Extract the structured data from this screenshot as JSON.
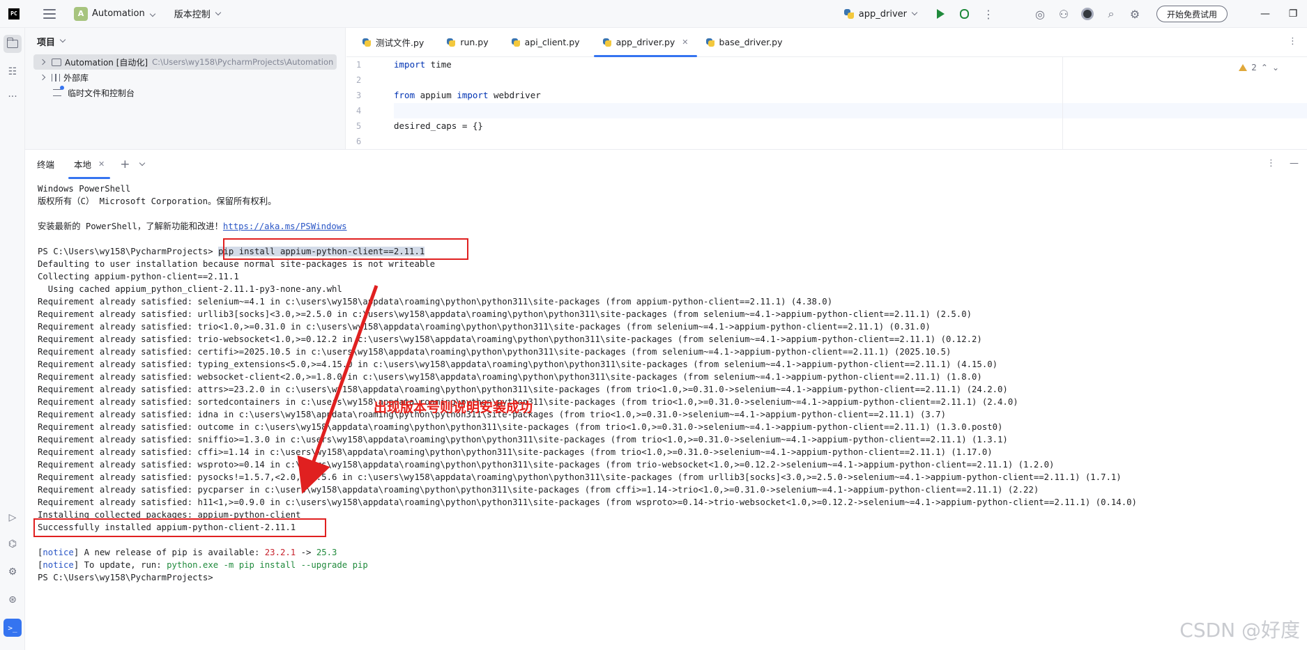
{
  "titlebar": {
    "logo": "PC",
    "project_badge": "A",
    "project_name": "Automation",
    "vcs_label": "版本控制",
    "run_config": "app_driver",
    "upgrade_button": "开始免费试用"
  },
  "left_strip": {
    "icons": [
      "folder-icon",
      "structure-icon",
      "more-icon",
      "run-icon",
      "python-console-icon",
      "services-icon",
      "debug-icon",
      "terminal-icon"
    ]
  },
  "project_panel": {
    "title": "项目",
    "tree": [
      {
        "label": "Automation [自动化]",
        "path": "C:\\Users\\wy158\\PycharmProjects\\Automation"
      },
      {
        "label": "外部库",
        "path": ""
      },
      {
        "label": "临时文件和控制台",
        "path": ""
      }
    ]
  },
  "editor": {
    "tabs": [
      {
        "label": "测试文件.py",
        "active": false
      },
      {
        "label": "run.py",
        "active": false
      },
      {
        "label": "api_client.py",
        "active": false
      },
      {
        "label": "app_driver.py",
        "active": true
      },
      {
        "label": "base_driver.py",
        "active": false
      }
    ],
    "warnings": "2",
    "line_numbers": [
      "1",
      "2",
      "3",
      "4",
      "5",
      "6"
    ],
    "code": {
      "l1_kw": "import",
      "l1_rest": " time",
      "l3_kw1": "from",
      "l3_mid": " appium ",
      "l3_kw2": "import",
      "l3_rest": " webdriver",
      "l5": "desired_caps = {}"
    }
  },
  "terminal_panel": {
    "title": "终端",
    "tab_label": "本地",
    "lines": {
      "l1": "Windows PowerShell",
      "l2": "版权所有（C） Microsoft Corporation。保留所有权利。",
      "l4_text": "安装最新的 PowerShell，了解新功能和改进！",
      "l4_link": "https://aka.ms/PSWindows",
      "l6_prompt": "PS C:\\Users\\wy158\\PycharmProjects> ",
      "l6_cmd": "pip install appium-python-client==2.11.1",
      "l7": "Defaulting to user installation because normal site-packages is not writeable",
      "l8": "Collecting appium-python-client==2.11.1",
      "l9": "  Using cached appium_python_client-2.11.1-py3-none-any.whl",
      "req": [
        "Requirement already satisfied: selenium~=4.1 in c:\\users\\wy158\\appdata\\roaming\\python\\python311\\site-packages (from appium-python-client==2.11.1) (4.38.0)",
        "Requirement already satisfied: urllib3[socks]<3.0,>=2.5.0 in c:\\users\\wy158\\appdata\\roaming\\python\\python311\\site-packages (from selenium~=4.1->appium-python-client==2.11.1) (2.5.0)",
        "Requirement already satisfied: trio<1.0,>=0.31.0 in c:\\users\\wy158\\appdata\\roaming\\python\\python311\\site-packages (from selenium~=4.1->appium-python-client==2.11.1) (0.31.0)",
        "Requirement already satisfied: trio-websocket<1.0,>=0.12.2 in c:\\users\\wy158\\appdata\\roaming\\python\\python311\\site-packages (from selenium~=4.1->appium-python-client==2.11.1) (0.12.2)",
        "Requirement already satisfied: certifi>=2025.10.5 in c:\\users\\wy158\\appdata\\roaming\\python\\python311\\site-packages (from selenium~=4.1->appium-python-client==2.11.1) (2025.10.5)",
        "Requirement already satisfied: typing_extensions<5.0,>=4.15.0 in c:\\users\\wy158\\appdata\\roaming\\python\\python311\\site-packages (from selenium~=4.1->appium-python-client==2.11.1) (4.15.0)",
        "Requirement already satisfied: websocket-client<2.0,>=1.8.0 in c:\\users\\wy158\\appdata\\roaming\\python\\python311\\site-packages (from selenium~=4.1->appium-python-client==2.11.1) (1.8.0)",
        "Requirement already satisfied: attrs>=23.2.0 in c:\\users\\wy158\\appdata\\roaming\\python\\python311\\site-packages (from trio<1.0,>=0.31.0->selenium~=4.1->appium-python-client==2.11.1) (24.2.0)",
        "Requirement already satisfied: sortedcontainers in c:\\users\\wy158\\appdata\\roaming\\python\\python311\\site-packages (from trio<1.0,>=0.31.0->selenium~=4.1->appium-python-client==2.11.1) (2.4.0)",
        "Requirement already satisfied: idna in c:\\users\\wy158\\appdata\\roaming\\python\\python311\\site-packages (from trio<1.0,>=0.31.0->selenium~=4.1->appium-python-client==2.11.1) (3.7)",
        "Requirement already satisfied: outcome in c:\\users\\wy158\\appdata\\roaming\\python\\python311\\site-packages (from trio<1.0,>=0.31.0->selenium~=4.1->appium-python-client==2.11.1) (1.3.0.post0)",
        "Requirement already satisfied: sniffio>=1.3.0 in c:\\users\\wy158\\appdata\\roaming\\python\\python311\\site-packages (from trio<1.0,>=0.31.0->selenium~=4.1->appium-python-client==2.11.1) (1.3.1)",
        "Requirement already satisfied: cffi>=1.14 in c:\\users\\wy158\\appdata\\roaming\\python\\python311\\site-packages (from trio<1.0,>=0.31.0->selenium~=4.1->appium-python-client==2.11.1) (1.17.0)",
        "Requirement already satisfied: wsproto>=0.14 in c:\\users\\wy158\\appdata\\roaming\\python\\python311\\site-packages (from trio-websocket<1.0,>=0.12.2->selenium~=4.1->appium-python-client==2.11.1) (1.2.0)",
        "Requirement already satisfied: pysocks!=1.5.7,<2.0,>=1.5.6 in c:\\users\\wy158\\appdata\\roaming\\python\\python311\\site-packages (from urllib3[socks]<3.0,>=2.5.0->selenium~=4.1->appium-python-client==2.11.1) (1.7.1)",
        "Requirement already satisfied: pycparser in c:\\users\\wy158\\appdata\\roaming\\python\\python311\\site-packages (from cffi>=1.14->trio<1.0,>=0.31.0->selenium~=4.1->appium-python-client==2.11.1) (2.22)",
        "Requirement already satisfied: h11<1,>=0.9.0 in c:\\users\\wy158\\appdata\\roaming\\python\\python311\\site-packages (from wsproto>=0.14->trio-websocket<1.0,>=0.12.2->selenium~=4.1->appium-python-client==2.11.1) (0.14.0)"
      ],
      "installing": "Installing collected packages: appium-python-client",
      "success": "Successfully installed appium-python-client-2.11.1",
      "notice1_tag": "notice",
      "notice1_text": " A new release of pip is available: ",
      "notice1_old": "23.2.1",
      "notice1_arrow": " -> ",
      "notice1_new": "25.3",
      "notice2_tag": "notice",
      "notice2_text": " To update, run: ",
      "notice2_cmd": "python.exe -m pip install --upgrade pip",
      "final_prompt": "PS C:\\Users\\wy158\\PycharmProjects>"
    }
  },
  "annotation": "出现版本号则说明安装成功",
  "watermark": "CSDN @好度",
  "colors": {
    "accent": "#3574f0",
    "annotation_red": "#e02020",
    "keyword": "#0033b3",
    "green": "#208a3c"
  }
}
